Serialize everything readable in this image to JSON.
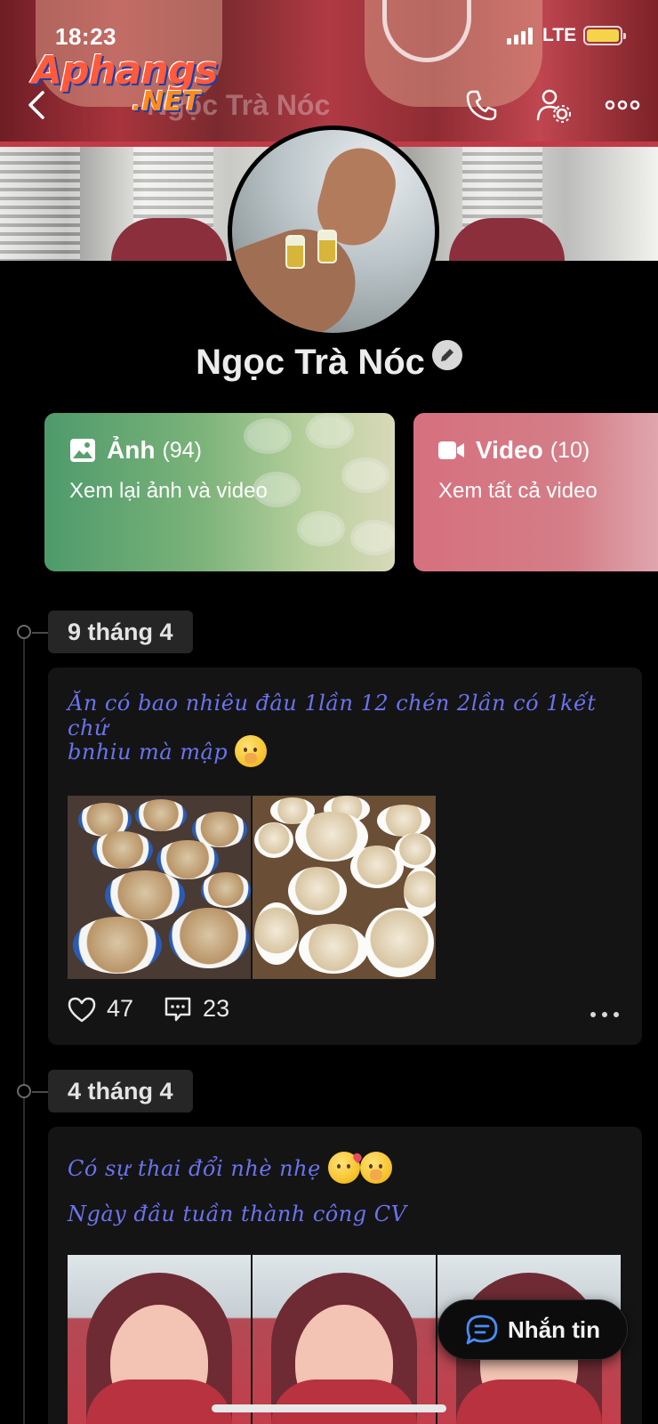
{
  "status_bar": {
    "time": "18:23",
    "network": "LTE"
  },
  "watermark": {
    "line1": "Aphangs",
    "line2": ".NET"
  },
  "nav": {
    "title": "Ngọc Trà Nóc"
  },
  "profile": {
    "name": "Ngọc Trà Nóc"
  },
  "media_cards": {
    "photos": {
      "title": "Ảnh",
      "count": "(94)",
      "subtitle": "Xem lại ảnh và video"
    },
    "videos": {
      "title": "Video",
      "count": "(10)",
      "subtitle": "Xem tất cả video"
    }
  },
  "posts": [
    {
      "date": "9 tháng 4",
      "lines": [
        "Ăn có bao nhiêu đâu 1lần 12 chén 2lần có 1kết chứ",
        "bnhiu mà mập"
      ],
      "likes": "47",
      "comments": "23"
    },
    {
      "date": "4 tháng 4",
      "lines": [
        "Có sự thai đổi nhè nhẹ",
        "Ngày đầu tuần thành công CV"
      ]
    }
  ],
  "message_button": {
    "label": "Nhắn tin"
  },
  "colors": {
    "post_text": "#6b73ee",
    "photos_card": "#6aa874",
    "videos_card": "#d6707e"
  }
}
